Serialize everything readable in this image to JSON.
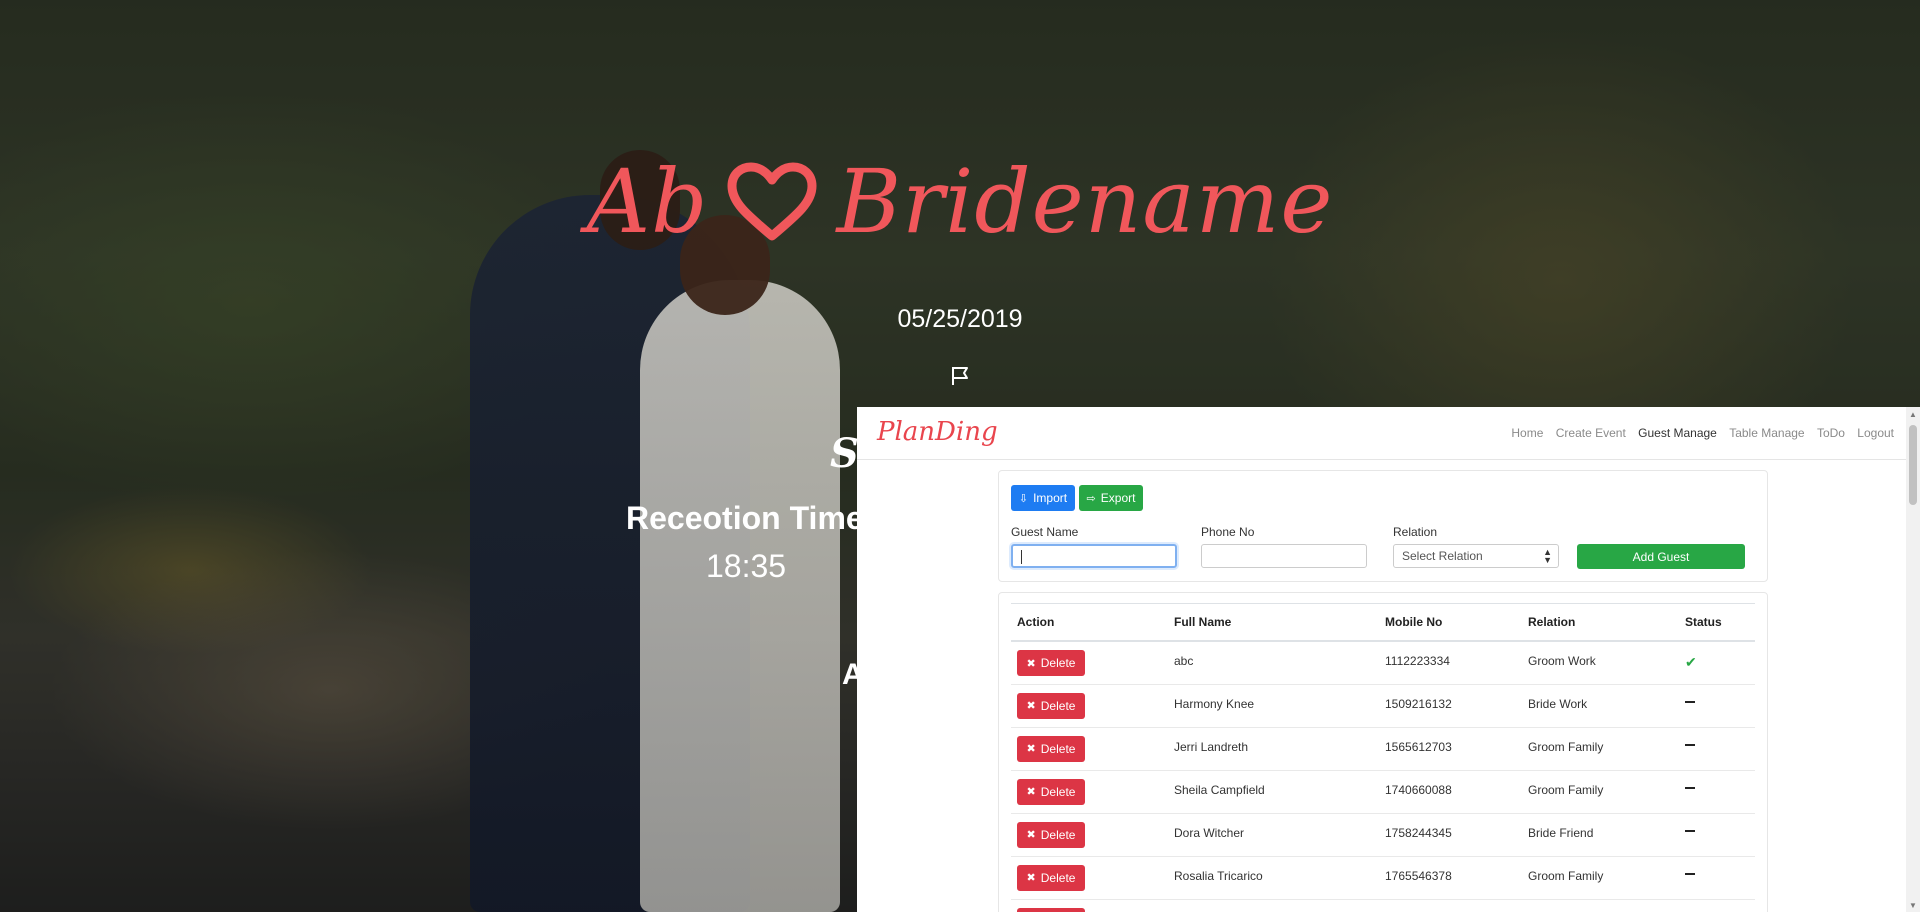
{
  "hero": {
    "name_left": "Ab",
    "name_right": "Bridename",
    "date": "05/25/2019",
    "partial_title": "Sa",
    "reception_label": "Receotion Time",
    "reception_time": "18:35",
    "partial_a": "A"
  },
  "colors": {
    "accent": "#e9454d",
    "primary": "#1e7cf2",
    "success": "#28a745",
    "danger": "#dc3545"
  },
  "navbar": {
    "brand": "PlanDing",
    "links": [
      "Home",
      "Create Event",
      "Guest Manage",
      "Table Manage",
      "ToDo",
      "Logout"
    ],
    "active": "Guest Manage"
  },
  "toolbar": {
    "import_label": "Import",
    "export_label": "Export"
  },
  "form": {
    "guest_name_label": "Guest Name",
    "guest_name_value": "",
    "phone_label": "Phone No",
    "phone_value": "",
    "relation_label": "Relation",
    "relation_selected": "Select Relation",
    "add_button": "Add Guest"
  },
  "table": {
    "headers": [
      "Action",
      "Full Name",
      "Mobile No",
      "Relation",
      "Status"
    ],
    "delete_label": "Delete",
    "rows": [
      {
        "name": "abc",
        "mobile": "1112223334",
        "relation": "Groom Work",
        "status": "confirmed"
      },
      {
        "name": "Harmony Knee",
        "mobile": "1509216132",
        "relation": "Bride Work",
        "status": "pending"
      },
      {
        "name": "Jerri Landreth",
        "mobile": "1565612703",
        "relation": "Groom Family",
        "status": "pending"
      },
      {
        "name": "Sheila Campfield",
        "mobile": "1740660088",
        "relation": "Groom Family",
        "status": "pending"
      },
      {
        "name": "Dora Witcher",
        "mobile": "1758244345",
        "relation": "Bride Friend",
        "status": "pending"
      },
      {
        "name": "Rosalia Tricarico",
        "mobile": "1765546378",
        "relation": "Groom Family",
        "status": "pending"
      }
    ]
  }
}
